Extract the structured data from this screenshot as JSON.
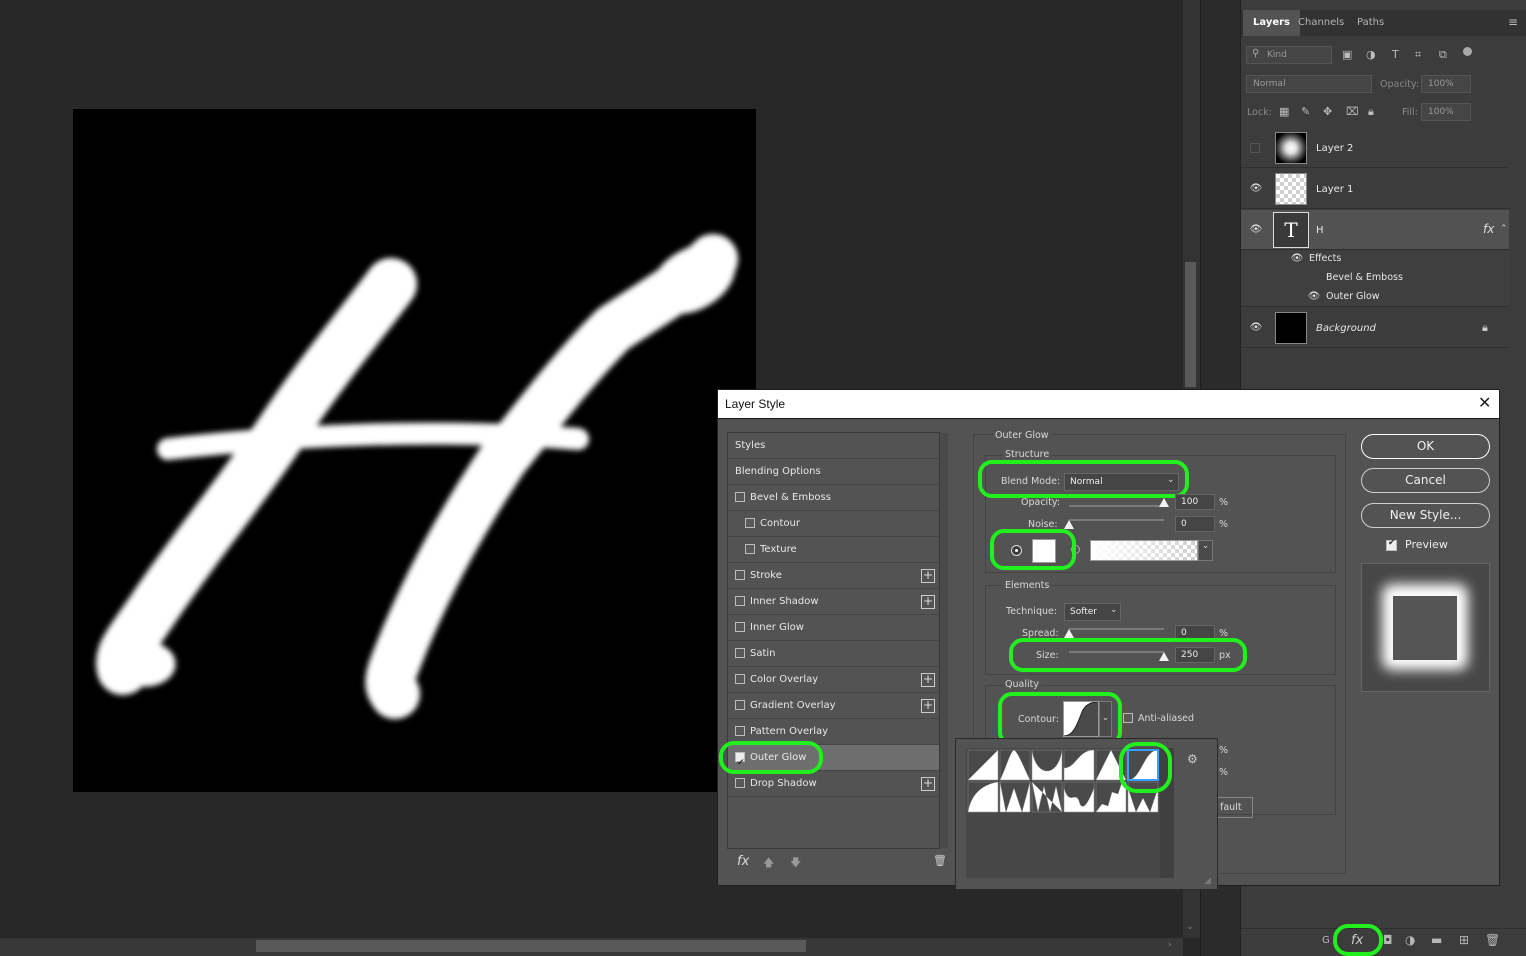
{
  "panel": {
    "tabs": [
      "Layers",
      "Channels",
      "Paths"
    ],
    "filter_placeholder": "Kind",
    "blend_mode": "Normal",
    "opacity_label": "Opacity:",
    "opacity_value": "100%",
    "lock_label": "Lock:",
    "fill_label": "Fill:",
    "fill_value": "100%",
    "layers": [
      {
        "name": "Layer 2"
      },
      {
        "name": "Layer 1"
      },
      {
        "name": "H",
        "fx": "fx"
      },
      {
        "name": "Background"
      }
    ],
    "effects_label": "Effects",
    "effect_items": [
      "Bevel & Emboss",
      "Outer Glow"
    ],
    "bottom_partial": "G"
  },
  "dialog": {
    "title": "Layer Style",
    "styles_header": "Styles",
    "blending_options": "Blending Options",
    "style_items": [
      {
        "label": "Bevel & Emboss",
        "checked": false
      },
      {
        "label": "Contour",
        "checked": false
      },
      {
        "label": "Texture",
        "checked": false
      },
      {
        "label": "Stroke",
        "checked": false
      },
      {
        "label": "Inner Shadow",
        "checked": false
      },
      {
        "label": "Inner Glow",
        "checked": false
      },
      {
        "label": "Satin",
        "checked": false
      },
      {
        "label": "Color Overlay",
        "checked": false
      },
      {
        "label": "Gradient Overlay",
        "checked": false
      },
      {
        "label": "Pattern Overlay",
        "checked": false
      },
      {
        "label": "Outer Glow",
        "checked": true
      },
      {
        "label": "Drop Shadow",
        "checked": false
      }
    ],
    "fx_label": "fx",
    "section_title": "Outer Glow",
    "structure": {
      "title": "Structure",
      "blend_mode_label": "Blend Mode:",
      "blend_mode_value": "Normal",
      "opacity_label": "Opacity:",
      "opacity_value": "100",
      "noise_label": "Noise:",
      "noise_value": "0",
      "percent": "%",
      "opacity_fraction": 1.0,
      "noise_fraction": 0.0
    },
    "elements": {
      "title": "Elements",
      "technique_label": "Technique:",
      "technique_value": "Softer",
      "spread_label": "Spread:",
      "spread_value": "0",
      "size_label": "Size:",
      "size_value": "250",
      "percent": "%",
      "px": "px",
      "spread_fraction": 0.0,
      "size_fraction": 1.0
    },
    "quality": {
      "title": "Quality",
      "contour_label": "Contour:",
      "anti_aliased_label": "Anti-aliased",
      "anti_aliased_checked": false,
      "percent": "%",
      "partial_button": "fault"
    },
    "buttons": {
      "ok": "OK",
      "cancel": "Cancel",
      "new_style": "New Style..."
    },
    "preview_label": "Preview",
    "preview_checked": true
  },
  "colors": {
    "highlight": "#22f01e",
    "canvas_bg": "#282828",
    "artboard": "#000000",
    "glow": "#ffffff"
  }
}
